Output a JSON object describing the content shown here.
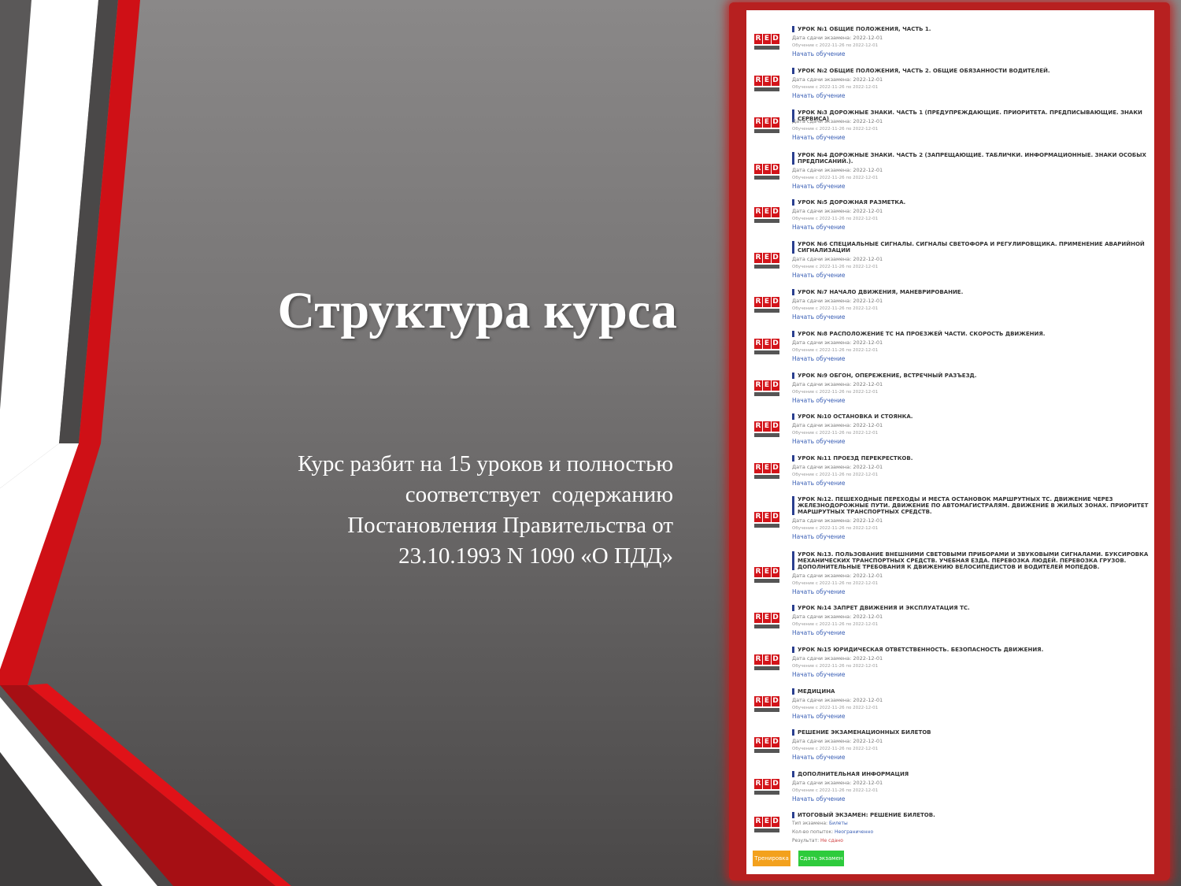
{
  "slide": {
    "title": "Структура курса",
    "subtitle_lines": [
      "Курс разбит на 15 уроков и полностью",
      "соответствует  содержанию",
      "Постановления Правительства от",
      "23.10.1993 N 1090 «О ПДД»"
    ]
  },
  "colors": {
    "accent_red": "#d3141a",
    "panel_red": "#b72020",
    "link_blue": "#3a5fb5",
    "button_orange": "#f3a11d",
    "button_green": "#2ecb3c"
  },
  "screenshot": {
    "logo_text": "RED",
    "lessons": [
      {
        "title": "Урок №1 общие положения, часть 1.",
        "exam": "Дата сдачи экзамена: 2022-12-01",
        "period": "Обучение с 2022-11-26 по 2022-12-01",
        "start": "Начать обучение"
      },
      {
        "title": "Урок №2 общие положения, часть 2. общие обязанности водителей.",
        "exam": "Дата сдачи экзамена: 2022-12-01",
        "period": "Обучение с 2022-11-26 по 2022-12-01",
        "start": "Начать обучение"
      },
      {
        "title": "Урок №3 дорожные знаки. часть 1 (предупреждающие. приоритета. предписывающие. знаки сервиса)",
        "exam": "Дата сдачи экзамена: 2022-12-01",
        "period": "Обучение с 2022-11-26 по 2022-12-01",
        "start": "Начать обучение"
      },
      {
        "title": "Урок №4 дорожные знаки. часть 2 (запрещающие. таблички. информационные. знаки особых предписаний.).",
        "exam": "Дата сдачи экзамена: 2022-12-01",
        "period": "Обучение с 2022-11-26 по 2022-12-01",
        "start": "Начать обучение"
      },
      {
        "title": "Урок №5 дорожная разметка.",
        "exam": "Дата сдачи экзамена: 2022-12-01",
        "period": "Обучение с 2022-11-26 по 2022-12-01",
        "start": "Начать обучение"
      },
      {
        "title": "Урок №6 специальные сигналы. сигналы светофора и регулировщика. применение аварийной сигнализации",
        "exam": "Дата сдачи экзамена: 2022-12-01",
        "period": "Обучение с 2022-11-26 по 2022-12-01",
        "start": "Начать обучение"
      },
      {
        "title": "Урок №7 начало движения, маневрирование.",
        "exam": "Дата сдачи экзамена: 2022-12-01",
        "period": "Обучение с 2022-11-26 по 2022-12-01",
        "start": "Начать обучение"
      },
      {
        "title": "Урок №8 расположение ТС на проезжей части. скорость движения.",
        "exam": "Дата сдачи экзамена: 2022-12-01",
        "period": "Обучение с 2022-11-26 по 2022-12-01",
        "start": "Начать обучение"
      },
      {
        "title": "Урок №9 обгон, опережение, встречный разъезд.",
        "exam": "Дата сдачи экзамена: 2022-12-01",
        "period": "Обучение с 2022-11-26 по 2022-12-01",
        "start": "Начать обучение"
      },
      {
        "title": "Урок №10 остановка и стоянка.",
        "exam": "Дата сдачи экзамена: 2022-12-01",
        "period": "Обучение с 2022-11-26 по 2022-12-01",
        "start": "Начать обучение"
      },
      {
        "title": "Урок №11 проезд перекрестков.",
        "exam": "Дата сдачи экзамена: 2022-12-01",
        "period": "Обучение с 2022-11-26 по 2022-12-01",
        "start": "Начать обучение"
      },
      {
        "title": "Урок №12. пешеходные переходы и места остановок маршрутных ТС. движение через железнодорожные пути. движение по автомагистралям. движение в жилых зонах. приоритет маршрутных транспортных средств.",
        "exam": "Дата сдачи экзамена: 2022-12-01",
        "period": "Обучение с 2022-11-26 по 2022-12-01",
        "start": "Начать обучение"
      },
      {
        "title": "Урок №13. пользование внешними световыми приборами и звуковыми сигналами. буксировка механических транспортных средств. учебная езда. перевозка людей. перевозка грузов. дополнительные требования к движению велосипедистов и водителей мопедов.",
        "exam": "Дата сдачи экзамена: 2022-12-01",
        "period": "Обучение с 2022-11-26 по 2022-12-01",
        "start": "Начать обучение"
      },
      {
        "title": "Урок №14 запрет движения и эксплуатация ТС.",
        "exam": "Дата сдачи экзамена: 2022-12-01",
        "period": "Обучение с 2022-11-26 по 2022-12-01",
        "start": "Начать обучение"
      },
      {
        "title": "Урок №15 юридическая ответственность. безопасность движения.",
        "exam": "Дата сдачи экзамена: 2022-12-01",
        "period": "Обучение с 2022-11-26 по 2022-12-01",
        "start": "Начать обучение"
      },
      {
        "title": "Медицина",
        "exam": "Дата сдачи экзамена: 2022-12-01",
        "period": "Обучение с 2022-11-26 по 2022-12-01",
        "start": "Начать обучение"
      },
      {
        "title": "Решение экзаменационных билетов",
        "exam": "Дата сдачи экзамена: 2022-12-01",
        "period": "Обучение с 2022-11-26 по 2022-12-01",
        "start": "Начать обучение"
      },
      {
        "title": "Дополнительная информация",
        "exam": "Дата сдачи экзамена: 2022-12-01",
        "period": "Обучение с 2022-11-26 по 2022-12-01",
        "start": "Начать обучение"
      }
    ],
    "final": {
      "title": "Итоговый экзамен: решение билетов.",
      "type_label": "Тип экзамена:",
      "type_value": "Билеты",
      "attempts_label": "Кол-во попыток:",
      "attempts_value": "Неограниченно",
      "result_label": "Результат:",
      "result_value": "Не сдано"
    },
    "buttons": {
      "training": "Тренировка",
      "take_exam": "Сдать экзамен"
    }
  }
}
